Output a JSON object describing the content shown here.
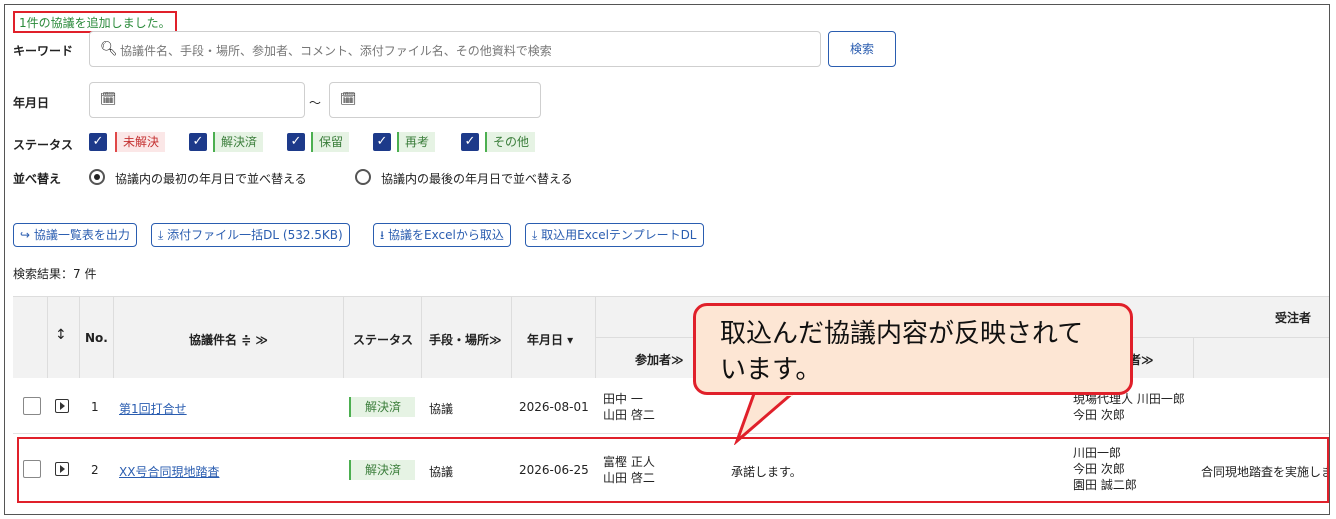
{
  "notice": "1件の協議を追加しました。",
  "search": {
    "label": "キーワード",
    "placeholder": "協議件名、手段・場所、参加者、コメント、添付ファイル名、その他資料で検索",
    "button": "検索"
  },
  "date": {
    "label": "年月日",
    "separator": "〜"
  },
  "status_filter": {
    "label": "ステータス",
    "items": [
      "未解決",
      "解決済",
      "保留",
      "再考",
      "その他"
    ]
  },
  "sort": {
    "label": "並べ替え",
    "options": [
      "協議内の最初の年月日で並べ替える",
      "協議内の最後の年月日で並べ替える"
    ],
    "selected": 0
  },
  "actions": [
    "協議一覧表を出力",
    "添付ファイル一括DL (532.5KB)",
    "協議をExcelから取込",
    "取込用ExcelテンプレートDL"
  ],
  "result_count": "検索結果：7 件",
  "table": {
    "headers": {
      "no": "No.",
      "title": "協議件名 ≑ ≫",
      "status": "ステータス",
      "method": "手段・場所≫",
      "date": "年月日 ▾",
      "participants": "参加者≫",
      "contractor": "受注者",
      "contractor_participants": "者≫"
    },
    "rows": [
      {
        "no": "1",
        "title": "第1回打合せ",
        "status": "解決済",
        "method": "協議",
        "date": "2026-08-01",
        "participants": [
          "田中 一",
          "山田 啓二"
        ],
        "comment": "",
        "contractor": [
          "現場代理人 川田一郎",
          "今田 次郎"
        ],
        "contractor_comment": ""
      },
      {
        "no": "2",
        "title": "XX号合同現地踏査",
        "status": "解決済",
        "method": "協議",
        "date": "2026-06-25",
        "participants": [
          "富樫 正人",
          "山田 啓二"
        ],
        "comment": "承諾します。",
        "contractor": [
          "川田一郎",
          "今田 次郎",
          "園田 誠二郎"
        ],
        "contractor_comment": "合同現地踏査を実施しま"
      }
    ]
  },
  "callout": "取込んだ協議内容が反映されています。",
  "colors": {
    "accent": "#2a5db0",
    "highlight": "#e0202a",
    "success": "#4caf50",
    "danger": "#e04848",
    "callout_bg": "#fde6d4"
  }
}
